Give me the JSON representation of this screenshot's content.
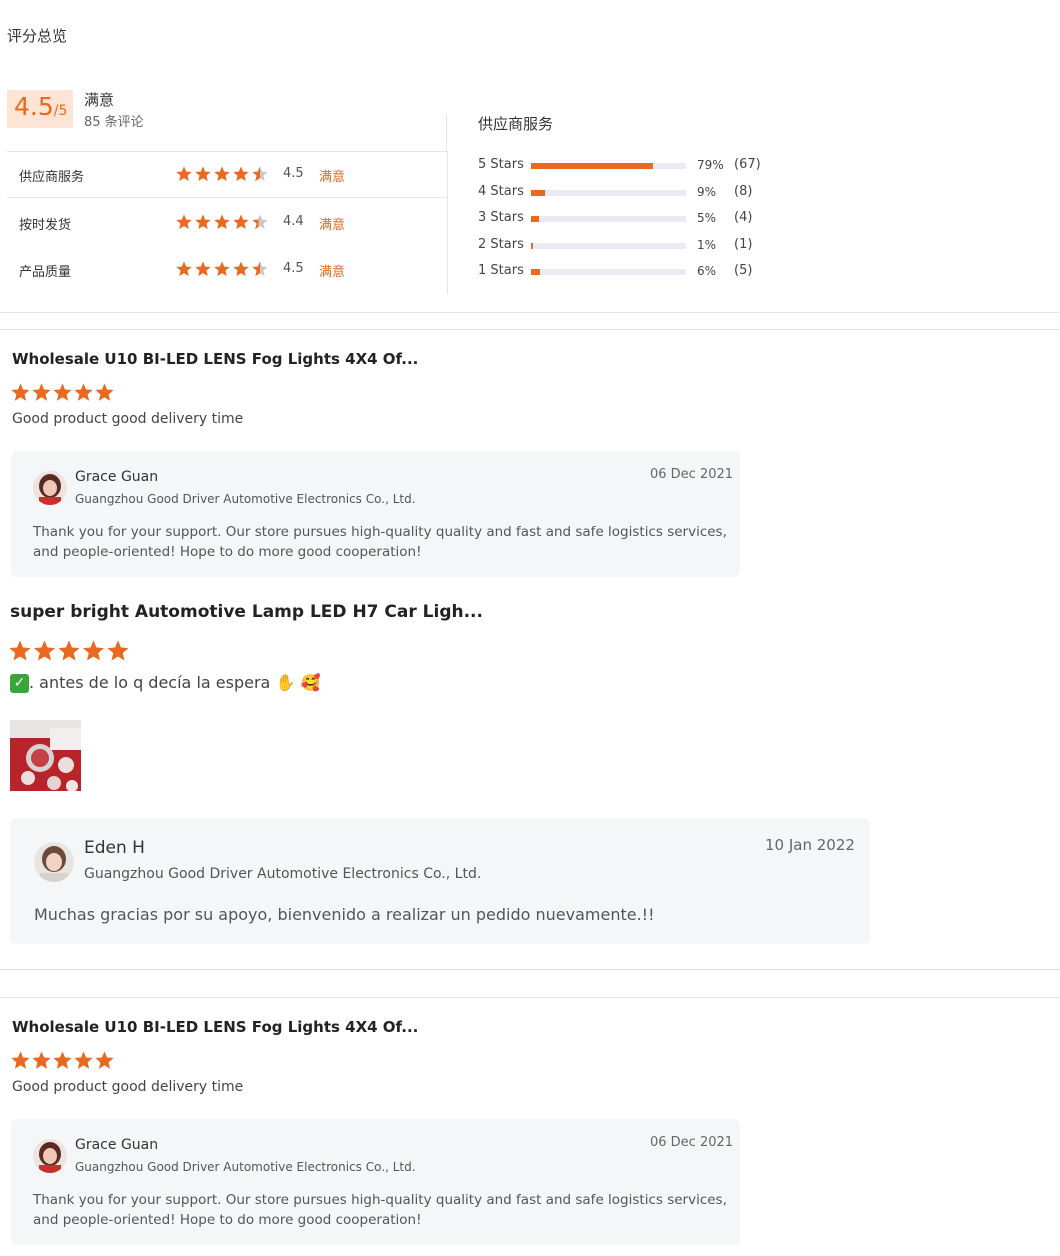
{
  "header": {
    "title": "评分总览"
  },
  "summary": {
    "score": "4.5",
    "score_suffix": "/5",
    "satisfaction": "满意",
    "review_count": "85 条评论"
  },
  "dimensions": [
    {
      "name": "供应商服务",
      "rating": 4.5,
      "value": "4.5",
      "word": "满意"
    },
    {
      "name": "按时发货",
      "rating": 4.4,
      "value": "4.4",
      "word": "满意"
    },
    {
      "name": "产品质量",
      "rating": 4.5,
      "value": "4.5",
      "word": "满意"
    }
  ],
  "distribution": {
    "title": "供应商服务",
    "rows": [
      {
        "label": "5  Stars",
        "fraction": 0.79,
        "pct": "79%",
        "count": "(67)"
      },
      {
        "label": "4  Stars",
        "fraction": 0.09,
        "pct": "9%",
        "count": "(8)"
      },
      {
        "label": "3  Stars",
        "fraction": 0.05,
        "pct": "5%",
        "count": "(4)"
      },
      {
        "label": "2  Stars",
        "fraction": 0.01,
        "pct": "1%",
        "count": "(1)"
      },
      {
        "label": "1  Stars",
        "fraction": 0.06,
        "pct": "6%",
        "count": "(5)"
      }
    ]
  },
  "reviews": [
    {
      "product": "Wholesale U10 BI-LED LENS Fog Lights 4X4 Of...",
      "stars": 5,
      "text": "Good product good delivery time",
      "reply": {
        "name": "Grace Guan",
        "company": "Guangzhou Good Driver Automotive Electronics Co., Ltd.",
        "date": "06 Dec 2021",
        "message": "Thank you for your support. Our store pursues high-quality quality and fast and safe logistics services, and people-oriented! Hope to do more good cooperation!"
      }
    },
    {
      "product": "super bright Automotive Lamp LED H7 Car Ligh...",
      "stars": 5,
      "text": ". antes de lo q decía la espera",
      "emoji": "✋ 🥰",
      "reply": {
        "name": "Eden H",
        "company": "Guangzhou Good Driver Automotive Electronics Co., Ltd.",
        "date": "10 Jan 2022",
        "message": "Muchas gracias por su apoyo, bienvenido a realizar un pedido nuevamente.!!"
      }
    },
    {
      "product": "Wholesale U10 BI-LED LENS Fog Lights 4X4 Of...",
      "stars": 5,
      "text": "Good product good delivery time",
      "reply": {
        "name": "Grace Guan",
        "company": "Guangzhou Good Driver Automotive Electronics Co., Ltd.",
        "date": "06 Dec 2021",
        "message": "Thank you for your support. Our store pursues high-quality quality and fast and safe logistics services, and people-oriented! Hope to do more good cooperation!"
      }
    }
  ],
  "colors": {
    "accent": "#e8691f",
    "score_bg": "#fde4d4",
    "reply_bg": "#f5f6f8",
    "check_green": "#3aa63a"
  },
  "icons": {
    "star": "star-icon",
    "half_star": "half-star-icon",
    "check": "check-box-icon",
    "hand": "raised-hand-emoji",
    "smile": "smiling-hearts-emoji"
  }
}
